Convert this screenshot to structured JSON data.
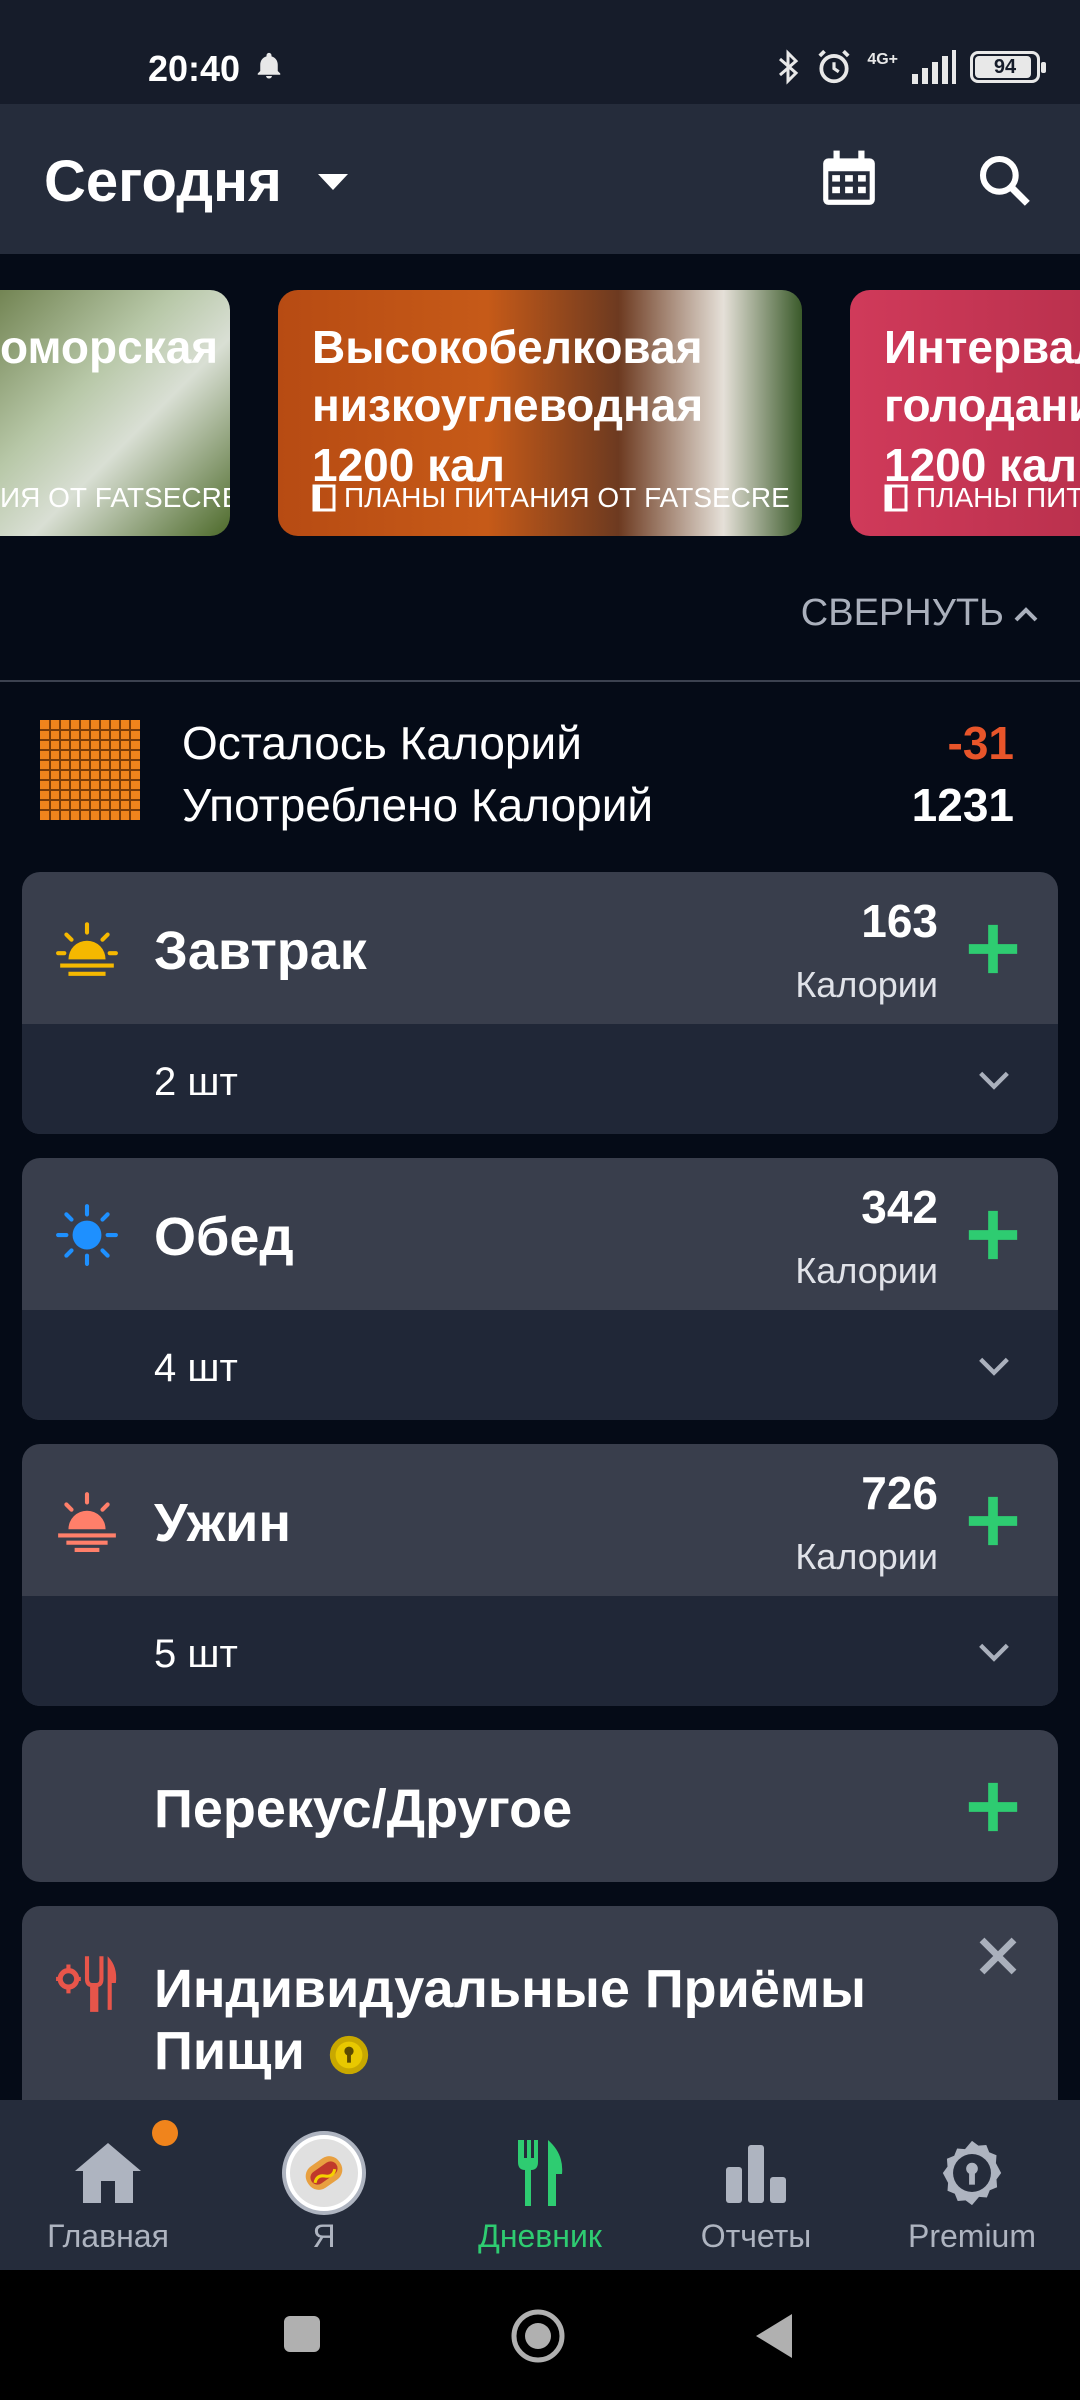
{
  "status_bar": {
    "time": "20:40",
    "battery": "94",
    "battery_level": 0.94,
    "network": "4G+"
  },
  "header": {
    "title": "Сегодня",
    "calendar_icon": "calendar-icon",
    "search_icon": "search-icon"
  },
  "meal_plans": [
    {
      "title_line1": "оморская",
      "title_line2": "",
      "kcal": "",
      "subtitle": "ИЯ ОТ FATSECRE"
    },
    {
      "title_line1": "Высокобелковая",
      "title_line2": "низкоуглеводная",
      "kcal": "1200 кал",
      "subtitle": "ПЛАНЫ ПИТАНИЯ ОТ FATSECRE"
    },
    {
      "title_line1": "Интервал",
      "title_line2": "голодани",
      "kcal": "1200 кал",
      "subtitle": "ПЛАНЫ ПИТ"
    }
  ],
  "collapse_label": "СВЕРНУТЬ",
  "summary": {
    "remaining_label": "Осталось Калорий",
    "remaining_value": "-31",
    "consumed_label": "Употреблено Калорий",
    "consumed_value": "1231"
  },
  "meals": [
    {
      "name": "Завтрак",
      "calories": "163",
      "calories_label": "Калории",
      "count": "2 шт",
      "icon": "sunrise-icon"
    },
    {
      "name": "Обед",
      "calories": "342",
      "calories_label": "Калории",
      "count": "4 шт",
      "icon": "sun-icon"
    },
    {
      "name": "Ужин",
      "calories": "726",
      "calories_label": "Калории",
      "count": "5 шт",
      "icon": "sunset-icon"
    },
    {
      "name": "Перекус/Другое",
      "icon": "moon-icon"
    },
    {
      "name": "Индивидуальные Приёмы Пищи",
      "icon": "custom-meals-icon"
    }
  ],
  "nav": [
    {
      "label": "Главная",
      "icon": "home-icon"
    },
    {
      "label": "Я",
      "icon": "avatar-icon"
    },
    {
      "label": "Дневник",
      "icon": "diary-icon",
      "active": true
    },
    {
      "label": "Отчеты",
      "icon": "reports-icon"
    },
    {
      "label": "Premium",
      "icon": "premium-icon"
    }
  ],
  "colors": {
    "accent_green": "#2ecc71",
    "negative_orange": "#e8552a",
    "card_bg": "#393e4c",
    "header_bg": "#252c3b"
  }
}
